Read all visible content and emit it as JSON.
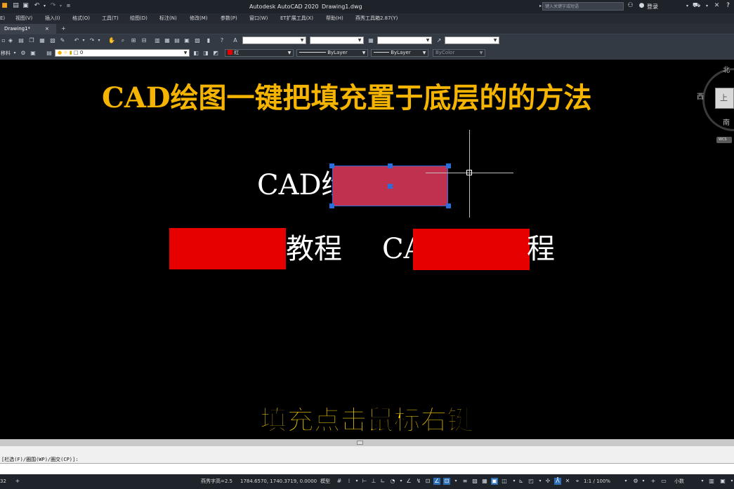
{
  "titlebar": {
    "app_title": "Autodesk AutoCAD 2020",
    "file_name": "Drawing1.dwg",
    "search_placeholder": "键入关键字或短语",
    "login_label": "登录"
  },
  "menu": {
    "items": [
      "E)",
      "视图(V)",
      "插入(I)",
      "格式(O)",
      "工具(T)",
      "绘图(D)",
      "标注(N)",
      "修改(M)",
      "参数(P)",
      "窗口(W)",
      "ET扩展工具(X)",
      "帮助(H)",
      "燕秀工具箱2.87(Y)"
    ]
  },
  "tabs": {
    "active": "Drawing1*",
    "close": "×",
    "add": "+"
  },
  "toolbar": {
    "text_style": "",
    "dim_style": "",
    "table_style": "",
    "mleader_style": "",
    "layer_value": "0",
    "layer_label": "移料",
    "color_value": "红",
    "linetype_value": "ByLayer",
    "lineweight_value": "ByLayer",
    "plotstyle_value": "ByColor"
  },
  "colors": {
    "fill_red": "#e60000",
    "selected_hatch": "#c0304f",
    "grip_blue": "#2a6ddb",
    "title_orange": "#f5b400",
    "subtitle_yellow": "#ffd400"
  },
  "drawing": {
    "title": "CAD绘图一键把填充置于底层的的方法",
    "text_cad": "CAD绘",
    "text_jiaocheng": "教程",
    "text_ca": "CA",
    "text_cheng": "程",
    "caption": "填充点击鼠标右键"
  },
  "viewcube": {
    "north": "北",
    "west": "西",
    "south": "南",
    "face": "上",
    "wcs": "WCS"
  },
  "command": {
    "history": "[栏选(F)/圈围(WP)/圈交(CP)]:",
    "input": ""
  },
  "status": {
    "left_marker": "32",
    "text_height": "燕秀字高=2.5",
    "coordinates": "1784.6570, 1740.3719, 0.0000",
    "model": "模型",
    "scale": "1:1 / 100%",
    "units": "小数"
  }
}
